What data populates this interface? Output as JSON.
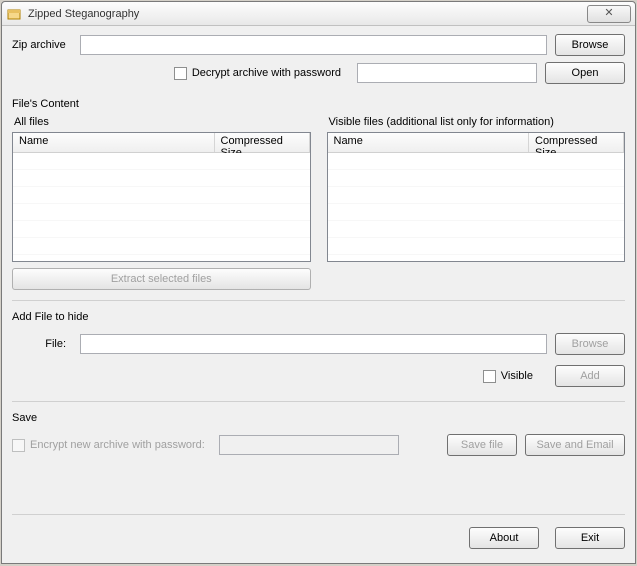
{
  "window": {
    "title": "Zipped Steganography"
  },
  "zip": {
    "label": "Zip archive",
    "value": "",
    "browse": "Browse",
    "decrypt_label": "Decrypt archive with password",
    "password_value": "",
    "open": "Open"
  },
  "filesContent": {
    "section": "File's Content",
    "allFiles": {
      "label": "All files",
      "columns": {
        "name": "Name",
        "size": "Compressed Size"
      },
      "rows": []
    },
    "visibleFiles": {
      "label": "Visible files (additional list only for information)",
      "columns": {
        "name": "Name",
        "size": "Compressed Size"
      },
      "rows": []
    },
    "extract": "Extract selected files"
  },
  "addFile": {
    "section": "Add File to hide",
    "file_label": "File:",
    "file_value": "",
    "browse": "Browse",
    "visible_label": "Visible",
    "add": "Add"
  },
  "save": {
    "section": "Save",
    "encrypt_label": "Encrypt new archive with password:",
    "password_value": "",
    "saveFile": "Save file",
    "saveEmail": "Save and Email"
  },
  "footer": {
    "about": "About",
    "exit": "Exit"
  }
}
